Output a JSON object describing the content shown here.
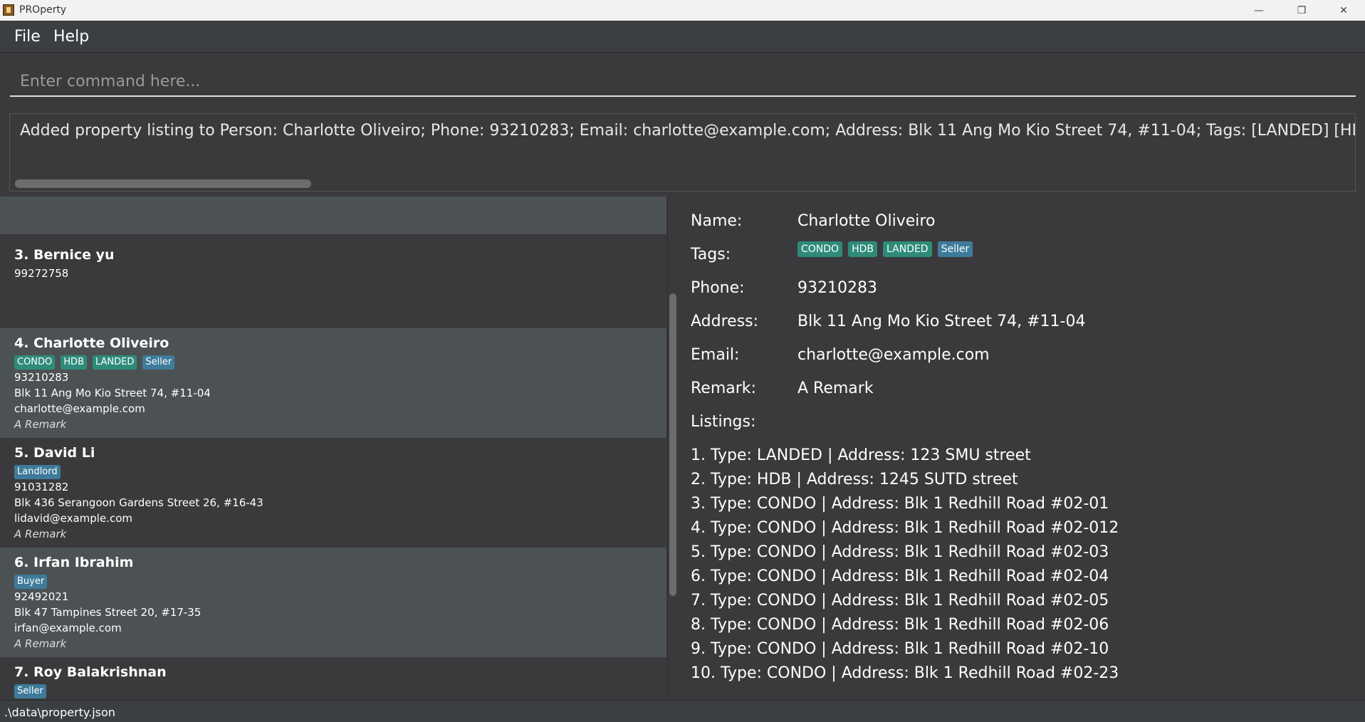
{
  "window": {
    "title": "PROperty"
  },
  "menu": {
    "file": "File",
    "help": "Help"
  },
  "command": {
    "placeholder": "Enter command here..."
  },
  "result": {
    "text": "Added property listing to Person: Charlotte Oliveiro; Phone: 93210283; Email: charlotte@example.com; Address: Blk 11 Ang Mo Kio Street 74, #11-04; Tags: [LANDED] [HDB] [CONDO] [Seller]; Remark: A Remar"
  },
  "persons": [
    {
      "name": "3. Bernice yu",
      "phone": "99272758"
    },
    {
      "name": "4. Charlotte Oliveiro",
      "tags": [
        "CONDO",
        "HDB",
        "LANDED",
        "Seller"
      ],
      "phone": "93210283",
      "address": "Blk 11 Ang Mo Kio Street 74, #11-04",
      "email": "charlotte@example.com",
      "remark": "A Remark"
    },
    {
      "name": "5. David Li",
      "tags": [
        "Landlord"
      ],
      "phone": "91031282",
      "address": "Blk 436 Serangoon Gardens Street 26, #16-43",
      "email": "lidavid@example.com",
      "remark": "A Remark"
    },
    {
      "name": "6. Irfan Ibrahim",
      "tags": [
        "Buyer"
      ],
      "phone": "92492021",
      "address": "Blk 47 Tampines Street 20, #17-35",
      "email": "irfan@example.com",
      "remark": "A Remark"
    },
    {
      "name": "7. Roy Balakrishnan",
      "tags": [
        "Seller"
      ]
    }
  ],
  "detail": {
    "labels": {
      "name": "Name:",
      "tags": "Tags:",
      "phone": "Phone:",
      "address": "Address:",
      "email": "Email:",
      "remark": "Remark:",
      "listings": "Listings:"
    },
    "name": "Charlotte Oliveiro",
    "tags": [
      "CONDO",
      "HDB",
      "LANDED",
      "Seller"
    ],
    "phone": "93210283",
    "address": "Blk 11 Ang Mo Kio Street 74, #11-04",
    "email": "charlotte@example.com",
    "remark": "A Remark",
    "listings": [
      "1. Type: LANDED | Address: 123 SMU street",
      "2. Type: HDB | Address: 1245 SUTD street",
      "3. Type: CONDO | Address: Blk 1 Redhill Road #02-01",
      "4. Type: CONDO | Address: Blk 1 Redhill Road #02-012",
      "5. Type: CONDO | Address: Blk 1 Redhill Road #02-03",
      "6. Type: CONDO | Address: Blk 1 Redhill Road #02-04",
      "7. Type: CONDO | Address: Blk 1 Redhill Road #02-05",
      "8. Type: CONDO | Address: Blk 1 Redhill Road #02-06",
      "9. Type: CONDO | Address: Blk 1 Redhill Road #02-10",
      "10. Type: CONDO | Address: Blk 1 Redhill Road #02-23"
    ]
  },
  "status": {
    "path": ".\\data\\property.json"
  },
  "colors": {
    "tag_property": "#2e8b7a",
    "tag_role": "#3e7b9a",
    "selected_card": "#4c5254",
    "background": "#3a3a3c"
  }
}
